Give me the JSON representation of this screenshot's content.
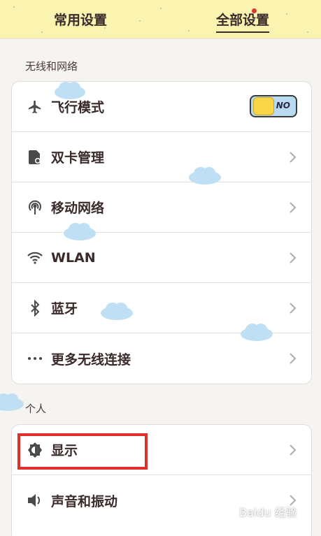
{
  "tabs": {
    "common": "常用设置",
    "all": "全部设置"
  },
  "sections": {
    "wireless": "无线和网络",
    "personal": "个人"
  },
  "wireless_items": [
    {
      "label": "飞行模式",
      "icon": "airplane-icon",
      "control": "toggle",
      "toggle_text": "NO"
    },
    {
      "label": "双卡管理",
      "icon": "sim-card-icon",
      "control": "chevron"
    },
    {
      "label": "移动网络",
      "icon": "mobile-network-icon",
      "control": "chevron"
    },
    {
      "label": "WLAN",
      "icon": "wifi-icon",
      "control": "chevron"
    },
    {
      "label": "蓝牙",
      "icon": "bluetooth-icon",
      "control": "chevron"
    },
    {
      "label": "更多无线连接",
      "icon": "more-dots-icon",
      "control": "chevron"
    }
  ],
  "personal_items": [
    {
      "label": "显示",
      "icon": "brightness-icon",
      "control": "chevron"
    },
    {
      "label": "声音和振动",
      "icon": "speaker-icon",
      "control": "chevron"
    }
  ],
  "watermark": "Baidu 经验",
  "colors": {
    "tab_bg": "#fbf3b0",
    "highlight": "#e0302a",
    "toggle_bg": "#b9daf0",
    "toggle_knob": "#f9d648"
  }
}
